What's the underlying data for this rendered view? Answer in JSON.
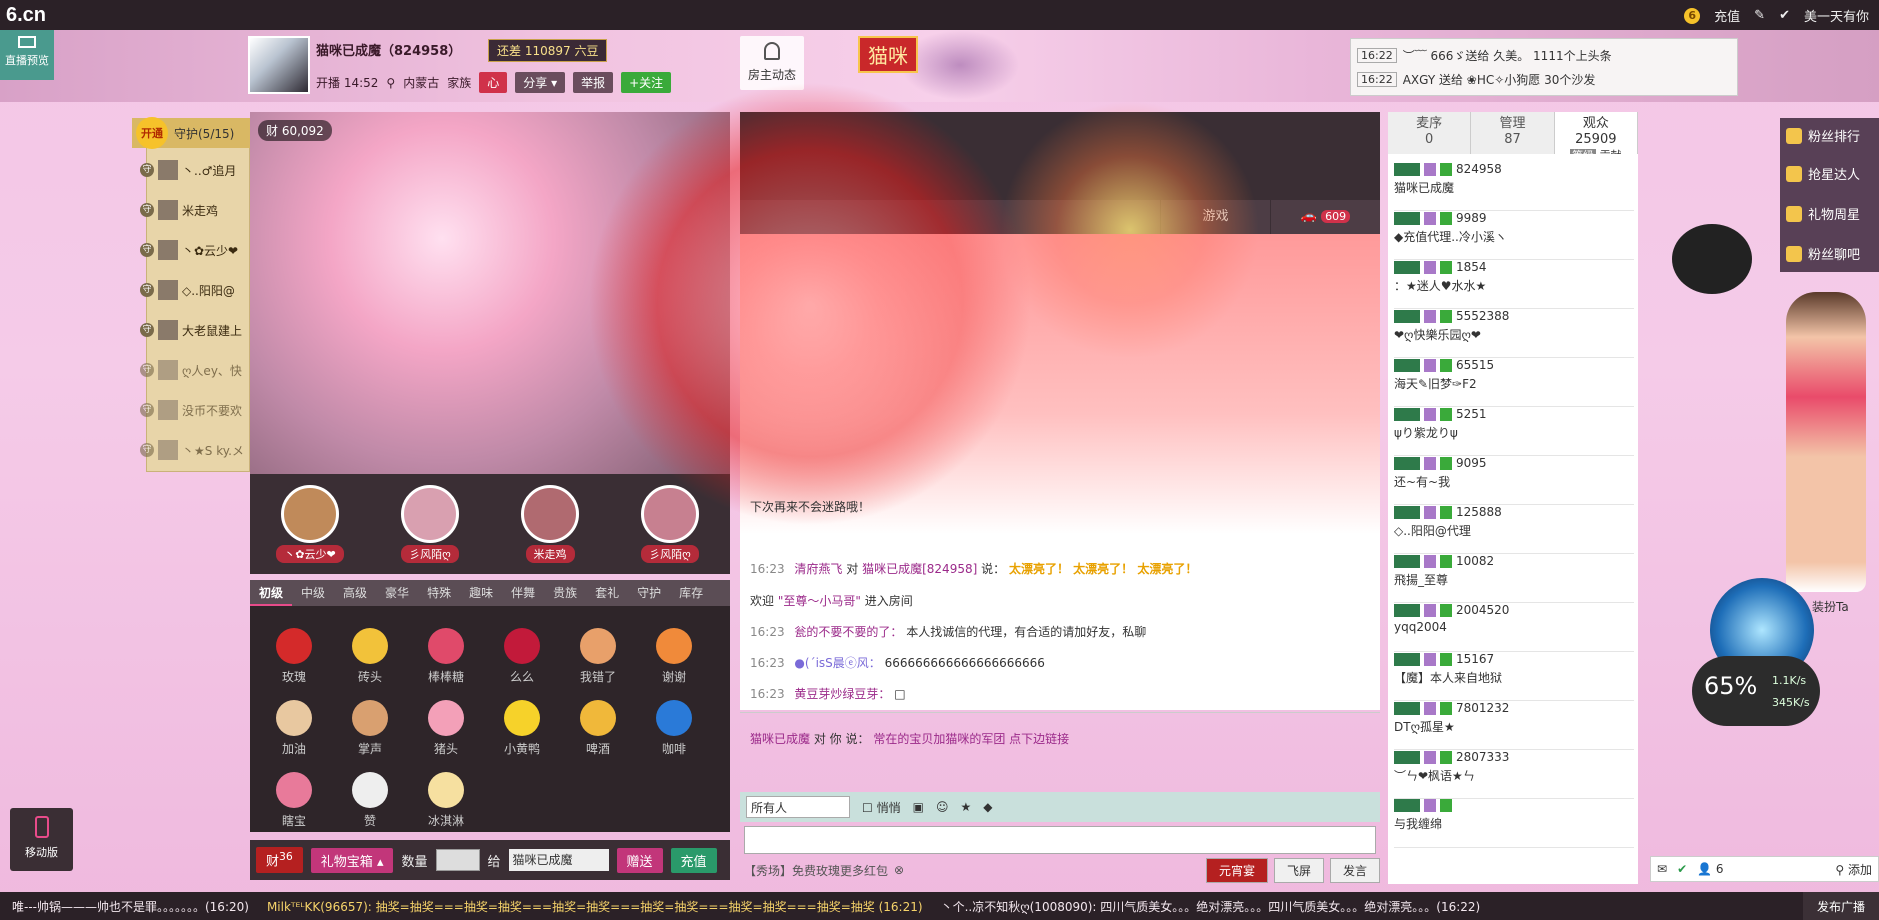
{
  "topbar": {
    "logo": "6.cn",
    "recharge": "充值",
    "user": "美一天有你"
  },
  "header": {
    "live_preview": "直播预览",
    "host_name": "猫咪已成魔（824958）",
    "gap_text": "还差 110897 六豆",
    "live_time": "开播 14:52",
    "location": "内蒙古",
    "family_label": "家族",
    "share": "分享",
    "report": "举报",
    "follow": "+关注",
    "host_dynamic": "房主动态",
    "room_badge": "猫咪"
  },
  "ticker": [
    {
      "time": "16:22",
      "text": "︶﹋ 666ゞ送给 久美。 1111个上头条"
    },
    {
      "time": "16:22",
      "text": "AXGY 送给 ❀HC✧小狗愿 30个沙发"
    }
  ],
  "guard": {
    "open": "开通",
    "title": "守护(5/15)",
    "items": [
      "丶..♂追月",
      "米走鸡",
      "丶✿云少❤",
      "◇..阳阳@",
      "大老鼠建上",
      "ღ人ey、快",
      "没币不要欢",
      "丶★S ky.メ"
    ]
  },
  "video": {
    "wealth": "60,092"
  },
  "top_fans": [
    "丶✿云少❤",
    "彡风陌ღ",
    "米走鸡",
    "彡风陌ღ"
  ],
  "gift_tabs": [
    "初级",
    "中级",
    "高级",
    "豪华",
    "特殊",
    "趣味",
    "伴舞",
    "贵族",
    "套礼",
    "守护",
    "库存"
  ],
  "gifts": [
    "玫瑰",
    "砖头",
    "棒棒糖",
    "么么",
    "我错了",
    "谢谢",
    "加油",
    "掌声",
    "猪头",
    "小黄鸭",
    "啤酒",
    "咖啡",
    "瞎宝",
    "赞",
    "冰淇淋"
  ],
  "gift_bar": {
    "count_badge": "36",
    "box": "礼物宝箱",
    "qty_label": "数量",
    "to_label": "给",
    "target": "猫咪已成魔",
    "send": "赠送",
    "recharge": "充值"
  },
  "chat_tabs": {
    "games": "游戏",
    "cars": "609"
  },
  "chat": {
    "m1_time": "16:23",
    "m1_user": "清府燕飞",
    "m1_mid": "对",
    "m1_to": "猫咪已成魔[824958]",
    "m1_says": "说：",
    "m1_body": "太漂亮了！  太漂亮了！  太漂亮了！",
    "m2_prefix": "欢迎",
    "m2_user": "\"至尊～小马哥\"",
    "m2_body": "进入房间",
    "m3_time": "16:23",
    "m3_user": "瓮的不要不要的了：",
    "m3_body": "本人找诚信的代理，有合适的请加好友，私聊",
    "m4_time": "16:23",
    "m4_user": "●(ˊisS晨ⓔ风：",
    "m4_body": "666666666666666666666",
    "m5_time": "16:23",
    "m5_user": "黄豆芽炒绿豆芽：",
    "m5_body": "□",
    "m6_body": "下次再来不会迷路哦！",
    "pinned_user": "猫咪已成魔",
    "pinned_mid": "对 你 说：",
    "pinned_body": "常在的宝贝加猫咪的军团 点下边链接"
  },
  "chat_tools": {
    "to": "所有人",
    "whisper": "悄悄",
    "footer_link": "【秀场】免费玫瑰更多红包",
    "yuanxiao": "元宵宴",
    "fly": "飞屏",
    "send": "发言"
  },
  "audience_tabs": [
    {
      "label": "麦序",
      "count": "0"
    },
    {
      "label": "管理",
      "count": "87"
    },
    {
      "label": "观众",
      "count": "25909"
    }
  ],
  "audience_sub": {
    "level": "等级",
    "contrib": "贡献"
  },
  "audience": [
    {
      "id": "824958",
      "name": "猫咪已成魔"
    },
    {
      "id": "9989",
      "name": "◆充值代理..冷小溪ヽ"
    },
    {
      "id": "1854",
      "name": "：★迷人♥水水★"
    },
    {
      "id": "5552388",
      "name": "❤ღ快樂乐园ღ❤"
    },
    {
      "id": "65515",
      "name": "海天✎旧梦✑F2"
    },
    {
      "id": "5251",
      "name": "ψり紫龙りψ"
    },
    {
      "id": "9095",
      "name": "还~有~我"
    },
    {
      "id": "125888",
      "name": "◇..阳阳@代理"
    },
    {
      "id": "10082",
      "name": "飛揚_至尊"
    },
    {
      "id": "2004520",
      "name": "yqq2004"
    },
    {
      "id": "15167",
      "name": "【魔】本人来自地狱"
    },
    {
      "id": "7801232",
      "name": "DTღ孤星★"
    },
    {
      "id": "2807333",
      "name": "︶ㄣ❤枫语★ㄣ"
    },
    {
      "id": "",
      "name": "与我缠绵"
    }
  ],
  "right_float": [
    "粉丝排行",
    "抢星达人",
    "礼物周星",
    "粉丝聊吧"
  ],
  "widgets": {
    "speed_pct": "65%",
    "up": "1.1K/s",
    "down": "345K/s",
    "dress": "装扮Ta",
    "mini_count": "6",
    "mini_add": "添加",
    "mobile": "移动版"
  },
  "marquee": [
    "唯---帅锅———帅也不是罪。。。。。。。(16:20)",
    "MilkᵀᴱᴸKK(96657): 抽奖=抽奖===抽奖=抽奖===抽奖=抽奖===抽奖=抽奖===抽奖=抽奖===抽奖=抽奖 (16:21)",
    "丶个..凉不知秋ღ(1008090): 四川气质美女。。。绝对漂亮。。。四川气质美女。。。绝对漂亮。。。(16:22)"
  ],
  "marquee_publish": "发布广播"
}
